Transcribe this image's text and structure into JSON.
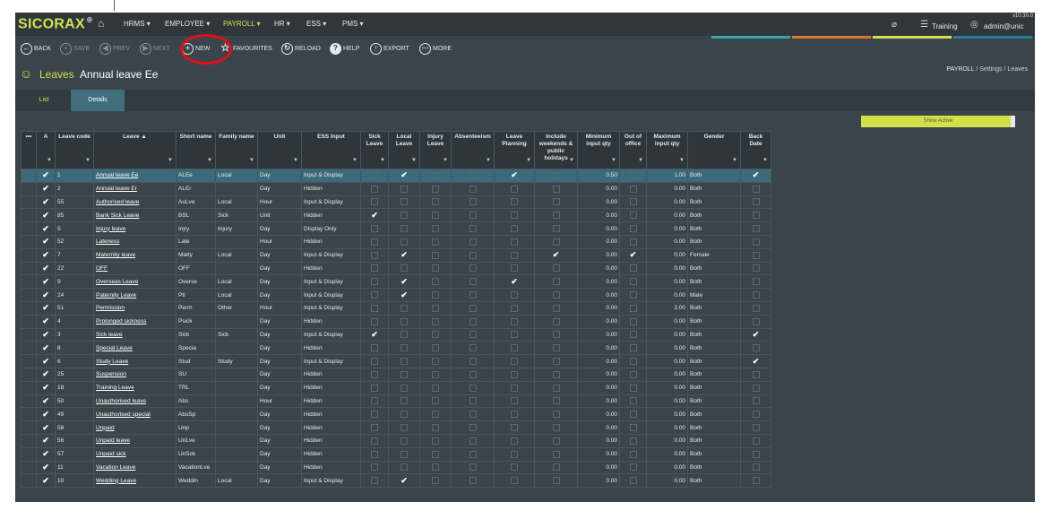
{
  "app": {
    "logo": "SICORAX",
    "logo_mark": "®",
    "version": "v10.30.0",
    "menu": [
      "HRMS ▾",
      "EMPLOYEE ▾",
      "PAYROLL ▾",
      "HR ▾",
      "ESS ▾",
      "PMS ▾"
    ],
    "active_menu": "PAYROLL ▾",
    "env": "Training",
    "user": "admin@unic",
    "accent": "#d4e04a"
  },
  "toolbar": {
    "back": "BACK",
    "save": "SAVE",
    "prev": "PREV",
    "next": "NEXT",
    "new": "NEW",
    "favourites": "FAVOURITES",
    "reload": "RELOAD",
    "help": "HELP",
    "export": "EXPORT",
    "more": "MORE"
  },
  "breadcrumb": {
    "a": "PAYROLL",
    "sep1": "/",
    "b": "Settings",
    "sep2": "/",
    "c": "Leaves"
  },
  "title": {
    "module": "Leaves",
    "record": "Annual leave Ee"
  },
  "tabs": {
    "list": "List",
    "details": "Details"
  },
  "show_active": "Show Active",
  "headers": {
    "menu": "•••",
    "active": "A",
    "code": "Leave code",
    "leave": "Leave ▲",
    "short": "Short name",
    "family": "Family name",
    "unit": "Unit",
    "ess": "ESS Input",
    "sick": "Sick Leave",
    "local": "Local Leave",
    "injury": "Injury Leave",
    "absent": "Absenteeism",
    "planning": "Leave Planning",
    "weekends": "Include weekends & public holidays",
    "min": "Minimum input qty",
    "outoffice": "Out of office",
    "max": "Maximum input qty",
    "gender": "Gender",
    "backdate": "Back Date",
    "filter": "▼"
  },
  "check": "✔",
  "rows": [
    {
      "code": "1",
      "name": "Annual leave Ee",
      "short": "ALEe",
      "family": "Local",
      "unit": "Day",
      "ess": "Input & Display",
      "sick": false,
      "local": true,
      "injury": false,
      "absent": false,
      "planning": true,
      "weekends": false,
      "min": "0.50",
      "ooo": false,
      "max": "1.00",
      "gender": "Both",
      "back": true
    },
    {
      "code": "2",
      "name": "Annual leave Er",
      "short": "ALEr",
      "family": "",
      "unit": "Day",
      "ess": "Hidden",
      "sick": false,
      "local": false,
      "injury": false,
      "absent": false,
      "planning": false,
      "weekends": false,
      "min": "0.00",
      "ooo": false,
      "max": "0.00",
      "gender": "Both",
      "back": false
    },
    {
      "code": "55",
      "name": "Authorised leave",
      "short": "AuLve",
      "family": "Local",
      "unit": "Hour",
      "ess": "Input & Display",
      "sick": false,
      "local": false,
      "injury": false,
      "absent": false,
      "planning": false,
      "weekends": false,
      "min": "0.00",
      "ooo": false,
      "max": "0.00",
      "gender": "Both",
      "back": false
    },
    {
      "code": "85",
      "name": "Bank Sick Leave",
      "short": "BSL",
      "family": "Sick",
      "unit": "Unit",
      "ess": "Hidden",
      "sick": true,
      "local": false,
      "injury": false,
      "absent": false,
      "planning": false,
      "weekends": false,
      "min": "0.00",
      "ooo": false,
      "max": "0.00",
      "gender": "Both",
      "back": false
    },
    {
      "code": "5",
      "name": "Injury leave",
      "short": "Injry",
      "family": "Injury",
      "unit": "Day",
      "ess": "Display Only",
      "sick": false,
      "local": false,
      "injury": false,
      "absent": false,
      "planning": false,
      "weekends": false,
      "min": "0.00",
      "ooo": false,
      "max": "0.00",
      "gender": "Both",
      "back": false
    },
    {
      "code": "52",
      "name": "Lateness",
      "short": "Late",
      "family": "",
      "unit": "Hour",
      "ess": "Hidden",
      "sick": false,
      "local": false,
      "injury": false,
      "absent": false,
      "planning": false,
      "weekends": false,
      "min": "0.00",
      "ooo": false,
      "max": "0.00",
      "gender": "Both",
      "back": false
    },
    {
      "code": "7",
      "name": "Maternity leave",
      "short": "Matty",
      "family": "Local",
      "unit": "Day",
      "ess": "Input & Display",
      "sick": false,
      "local": true,
      "injury": false,
      "absent": false,
      "planning": false,
      "weekends": true,
      "min": "0.00",
      "ooo": true,
      "max": "0.00",
      "gender": "Female",
      "back": false
    },
    {
      "code": "22",
      "name": "OFF",
      "short": "OFF",
      "family": "",
      "unit": "Day",
      "ess": "Hidden",
      "sick": false,
      "local": false,
      "injury": false,
      "absent": false,
      "planning": false,
      "weekends": false,
      "min": "0.00",
      "ooo": false,
      "max": "0.00",
      "gender": "Both",
      "back": false
    },
    {
      "code": "9",
      "name": "Overseas Leave",
      "short": "Overse",
      "family": "Local",
      "unit": "Day",
      "ess": "Input & Display",
      "sick": false,
      "local": true,
      "injury": false,
      "absent": false,
      "planning": true,
      "weekends": false,
      "min": "0.00",
      "ooo": false,
      "max": "0.00",
      "gender": "Both",
      "back": false
    },
    {
      "code": "24",
      "name": "Paternity Leave",
      "short": "Ptl",
      "family": "Local",
      "unit": "Day",
      "ess": "Input & Display",
      "sick": false,
      "local": true,
      "injury": false,
      "absent": false,
      "planning": false,
      "weekends": false,
      "min": "0.00",
      "ooo": false,
      "max": "0.00",
      "gender": "Male",
      "back": false
    },
    {
      "code": "51",
      "name": "Permission",
      "short": "Perm",
      "family": "Other",
      "unit": "Hour",
      "ess": "Input & Display",
      "sick": false,
      "local": false,
      "injury": false,
      "absent": false,
      "planning": false,
      "weekends": false,
      "min": "0.00",
      "ooo": false,
      "max": "2.00",
      "gender": "Both",
      "back": false
    },
    {
      "code": "4",
      "name": "Prolonged sickness",
      "short": "Psick",
      "family": "",
      "unit": "Day",
      "ess": "Hidden",
      "sick": false,
      "local": false,
      "injury": false,
      "absent": false,
      "planning": false,
      "weekends": false,
      "min": "0.00",
      "ooo": false,
      "max": "0.00",
      "gender": "Both",
      "back": false
    },
    {
      "code": "3",
      "name": "Sick leave",
      "short": "Sick",
      "family": "Sick",
      "unit": "Day",
      "ess": "Input & Display",
      "sick": true,
      "local": false,
      "injury": false,
      "absent": false,
      "planning": false,
      "weekends": false,
      "min": "0.00",
      "ooo": false,
      "max": "0.00",
      "gender": "Both",
      "back": true
    },
    {
      "code": "8",
      "name": "Special Leave",
      "short": "Specia",
      "family": "",
      "unit": "Day",
      "ess": "Hidden",
      "sick": false,
      "local": false,
      "injury": false,
      "absent": false,
      "planning": false,
      "weekends": false,
      "min": "0.00",
      "ooo": false,
      "max": "0.00",
      "gender": "Both",
      "back": false
    },
    {
      "code": "6",
      "name": "Study Leave",
      "short": "Stud",
      "family": "Study",
      "unit": "Day",
      "ess": "Input & Display",
      "sick": false,
      "local": false,
      "injury": false,
      "absent": false,
      "planning": false,
      "weekends": false,
      "min": "0.00",
      "ooo": false,
      "max": "0.00",
      "gender": "Both",
      "back": true
    },
    {
      "code": "25",
      "name": "Suspension",
      "short": "SU",
      "family": "",
      "unit": "Day",
      "ess": "Hidden",
      "sick": false,
      "local": false,
      "injury": false,
      "absent": false,
      "planning": false,
      "weekends": false,
      "min": "0.00",
      "ooo": false,
      "max": "0.00",
      "gender": "Both",
      "back": false
    },
    {
      "code": "18",
      "name": "Training Leave",
      "short": "TRL",
      "family": "",
      "unit": "Day",
      "ess": "Hidden",
      "sick": false,
      "local": false,
      "injury": false,
      "absent": false,
      "planning": false,
      "weekends": false,
      "min": "0.00",
      "ooo": false,
      "max": "0.00",
      "gender": "Both",
      "back": false
    },
    {
      "code": "50",
      "name": "Unauthorised leave",
      "short": "Abs",
      "family": "",
      "unit": "Hour",
      "ess": "Hidden",
      "sick": false,
      "local": false,
      "injury": false,
      "absent": false,
      "planning": false,
      "weekends": false,
      "min": "0.00",
      "ooo": false,
      "max": "0.00",
      "gender": "Both",
      "back": false
    },
    {
      "code": "49",
      "name": "Unauthorised special",
      "short": "AbsSp",
      "family": "",
      "unit": "Day",
      "ess": "Hidden",
      "sick": false,
      "local": false,
      "injury": false,
      "absent": false,
      "planning": false,
      "weekends": false,
      "min": "0.00",
      "ooo": false,
      "max": "0.00",
      "gender": "Both",
      "back": false
    },
    {
      "code": "58",
      "name": "Unpaid",
      "short": "Unp",
      "family": "",
      "unit": "Day",
      "ess": "Hidden",
      "sick": false,
      "local": false,
      "injury": false,
      "absent": false,
      "planning": false,
      "weekends": false,
      "min": "0.00",
      "ooo": false,
      "max": "0.00",
      "gender": "Both",
      "back": false
    },
    {
      "code": "56",
      "name": "Unpaid leave",
      "short": "UnLve",
      "family": "",
      "unit": "Day",
      "ess": "Hidden",
      "sick": false,
      "local": false,
      "injury": false,
      "absent": false,
      "planning": false,
      "weekends": false,
      "min": "0.00",
      "ooo": false,
      "max": "0.00",
      "gender": "Both",
      "back": false
    },
    {
      "code": "57",
      "name": "Unpaid sick",
      "short": "UnSck",
      "family": "",
      "unit": "Day",
      "ess": "Hidden",
      "sick": false,
      "local": false,
      "injury": false,
      "absent": false,
      "planning": false,
      "weekends": false,
      "min": "0.00",
      "ooo": false,
      "max": "0.00",
      "gender": "Both",
      "back": false
    },
    {
      "code": "11",
      "name": "Vacation Leave",
      "short": "VacationLve",
      "family": "",
      "unit": "Day",
      "ess": "Hidden",
      "sick": false,
      "local": false,
      "injury": false,
      "absent": false,
      "planning": false,
      "weekends": false,
      "min": "0.00",
      "ooo": false,
      "max": "0.00",
      "gender": "Both",
      "back": false
    },
    {
      "code": "10",
      "name": "Wedding Leave",
      "short": "Weddin",
      "family": "Local",
      "unit": "Day",
      "ess": "Input & Display",
      "sick": false,
      "local": true,
      "injury": false,
      "absent": false,
      "planning": false,
      "weekends": false,
      "min": "0.00",
      "ooo": false,
      "max": "0.00",
      "gender": "Both",
      "back": false
    }
  ]
}
